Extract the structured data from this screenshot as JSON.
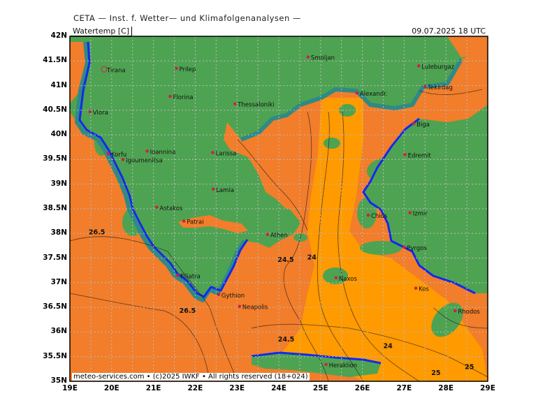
{
  "header": {
    "title": "CETA — Inst. f. Wetter— und Klimafolgenanalysen —"
  },
  "panel": {
    "variable": "Watertemp [C]",
    "datetime": "09.07.2025 18 UTC"
  },
  "footer": {
    "credit": "meteo-services.com • (c)2025 IWKF • All rights reserved (18+024)"
  },
  "axes": {
    "y_ticks": [
      "42N",
      "41.5N",
      "41N",
      "40.5N",
      "40N",
      "39.5N",
      "39N",
      "38.5N",
      "38N",
      "37.5N",
      "37N",
      "36.5N",
      "36N",
      "35.5N",
      "35N"
    ],
    "x_ticks": [
      "19E",
      "20E",
      "21E",
      "22E",
      "23E",
      "24E",
      "25E",
      "26E",
      "27E",
      "28E",
      "29E"
    ],
    "lat_range": [
      35,
      42
    ],
    "lon_range": [
      19,
      29
    ],
    "grid": true
  },
  "colors": {
    "sea_warm": "#f27d2a",
    "sea_cool": "#ff9a00",
    "land": "#4ea352",
    "coast_blue": "#1428ee",
    "coast_teal": "#2f8a86",
    "grid": "#bbbbbb"
  },
  "cities": [
    {
      "name": "Tirana",
      "lon": 19.82,
      "lat": 41.33
    },
    {
      "name": "Prilep",
      "lon": 21.55,
      "lat": 41.35
    },
    {
      "name": "Smoljan",
      "lon": 24.7,
      "lat": 41.58
    },
    {
      "name": "Luleburgaz",
      "lon": 27.35,
      "lat": 41.4
    },
    {
      "name": "Tekirdag",
      "lon": 27.5,
      "lat": 40.98
    },
    {
      "name": "Florina",
      "lon": 21.4,
      "lat": 40.78
    },
    {
      "name": "Thessaloniki",
      "lon": 22.95,
      "lat": 40.63
    },
    {
      "name": "Alexandr.",
      "lon": 25.87,
      "lat": 40.85
    },
    {
      "name": "Vlora",
      "lon": 19.48,
      "lat": 40.47
    },
    {
      "name": "Biga",
      "lon": 27.23,
      "lat": 40.23
    },
    {
      "name": "Korfu",
      "lon": 19.92,
      "lat": 39.62
    },
    {
      "name": "Ioannina",
      "lon": 20.85,
      "lat": 39.67
    },
    {
      "name": "Igoumenitsa",
      "lon": 20.27,
      "lat": 39.5
    },
    {
      "name": "Larissa",
      "lon": 22.42,
      "lat": 39.64
    },
    {
      "name": "Edremit",
      "lon": 27.02,
      "lat": 39.6
    },
    {
      "name": "Lamia",
      "lon": 22.43,
      "lat": 38.9
    },
    {
      "name": "Astakos",
      "lon": 21.08,
      "lat": 38.53
    },
    {
      "name": "Chios",
      "lon": 26.14,
      "lat": 38.37
    },
    {
      "name": "Izmir",
      "lon": 27.14,
      "lat": 38.42
    },
    {
      "name": "Patrai",
      "lon": 21.73,
      "lat": 38.25
    },
    {
      "name": "Athen",
      "lon": 23.73,
      "lat": 37.98
    },
    {
      "name": "Pyrgos",
      "lon": 27.0,
      "lat": 37.72
    },
    {
      "name": "Filiatra",
      "lon": 21.58,
      "lat": 37.15
    },
    {
      "name": "Gythion",
      "lon": 22.56,
      "lat": 36.76
    },
    {
      "name": "Naxos",
      "lon": 25.37,
      "lat": 37.1
    },
    {
      "name": "Kos",
      "lon": 27.28,
      "lat": 36.89
    },
    {
      "name": "Neapolis",
      "lon": 23.06,
      "lat": 36.52
    },
    {
      "name": "Rhodos",
      "lon": 28.22,
      "lat": 36.43
    },
    {
      "name": "Heraklion",
      "lon": 25.13,
      "lat": 35.34
    }
  ],
  "contour_labels": [
    {
      "text": "26.5",
      "lon": 19.45,
      "lat": 37.98
    },
    {
      "text": "24.5",
      "lon": 23.97,
      "lat": 37.42
    },
    {
      "text": "24",
      "lon": 24.68,
      "lat": 37.47
    },
    {
      "text": "26.5",
      "lon": 21.62,
      "lat": 36.39
    },
    {
      "text": "24.5",
      "lon": 23.98,
      "lat": 35.81
    },
    {
      "text": "24",
      "lon": 26.5,
      "lat": 35.67
    },
    {
      "text": "25",
      "lon": 28.45,
      "lat": 35.25
    },
    {
      "text": "25",
      "lon": 27.65,
      "lat": 35.13
    }
  ]
}
